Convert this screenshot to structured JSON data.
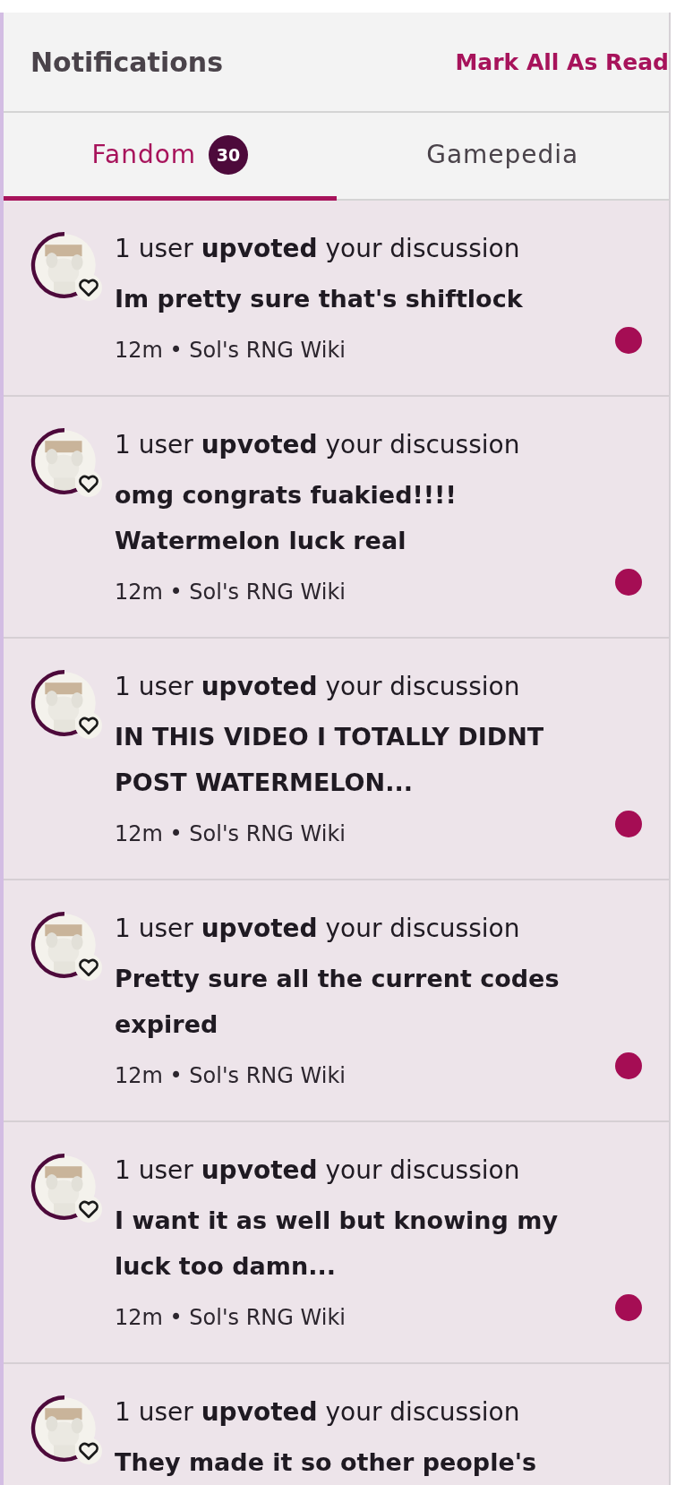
{
  "header": {
    "title": "Notifications",
    "action": "Mark All As Read"
  },
  "tabs": [
    {
      "label": "Fandom",
      "badge": "30",
      "selected": true
    },
    {
      "label": "Gamepedia",
      "selected": false
    }
  ],
  "notifications": [
    {
      "action": "1 user **upvoted** your discussion",
      "title": "Im pretty sure that's shiftlock",
      "meta": "12m • Sol's RNG Wiki",
      "unread": true
    },
    {
      "action": "1 user **upvoted** your discussion",
      "title": "omg congrats fuakied!!!! Watermelon luck real",
      "meta": "12m • Sol's RNG Wiki",
      "unread": true
    },
    {
      "action": "1 user **upvoted** your discussion",
      "title": "IN THIS VIDEO I TOTALLY DIDNT POST WATERMELON...",
      "meta": "12m • Sol's RNG Wiki",
      "unread": true
    },
    {
      "action": "1 user **upvoted** your discussion",
      "title": "Pretty sure all the current codes expired",
      "meta": "12m • Sol's RNG Wiki",
      "unread": true
    },
    {
      "action": "1 user **upvoted** your discussion",
      "title": "I want it as well but knowing my luck too damn...",
      "meta": "12m • Sol's RNG Wiki",
      "unread": true
    },
    {
      "action": "1 user **upvoted** your discussion",
      "title": "They made it so other people's"
    }
  ]
}
